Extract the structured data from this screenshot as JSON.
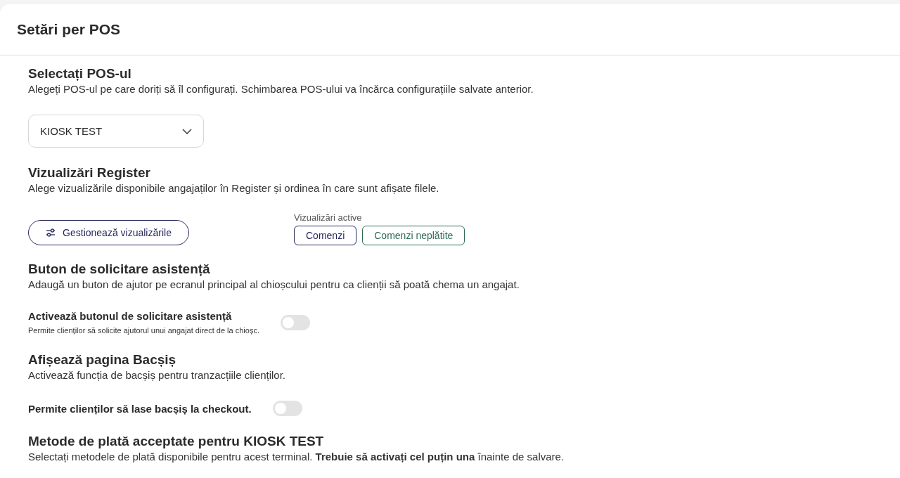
{
  "page": {
    "title": "Setări per POS"
  },
  "sections": [
    {
      "kind": "select",
      "title": "Selectați POS-ul",
      "description": "Alegeți POS-ul pe care doriți să îl configurați. Schimbarea POS-ului va încărca configurațiile salvate anterior.",
      "select": {
        "value": "KIOSK TEST"
      }
    },
    {
      "kind": "views",
      "title": "Vizualizări Register",
      "description": "Alege vizualizările disponibile angajaților în Register și ordinea în care sunt afișate filele.",
      "button": "Gestionează vizualizările",
      "active_label": "Vizualizări active",
      "chips": [
        {
          "label": "Comenzi",
          "color": "#27285c"
        },
        {
          "label": "Comenzi neplătite",
          "color": "#2e6b55"
        }
      ]
    },
    {
      "kind": "toggle",
      "title": "Buton de solicitare asistență",
      "description": "Adaugă un buton de ajutor pe ecranul principal al chioșcului pentru ca clienții să poată chema un angajat.",
      "setting": {
        "label": "Activează butonul de solicitare asistență",
        "hint": "Permite clienților să solicite ajutorul unui angajat direct de la chioșc.",
        "on": false
      }
    },
    {
      "kind": "toggle",
      "title": "Afișează pagina Bacșiș",
      "description": "Activează funcția de bacșiș pentru tranzacțiile clienților.",
      "setting": {
        "label": "Permite clienților să lase bacșiș la checkout.",
        "on": false
      }
    },
    {
      "kind": "text",
      "title": "Metode de plată acceptate pentru KIOSK TEST",
      "description": "Selectați metodele de plată disponibile pentru acest terminal. **Trebuie să activați cel puțin una** înainte de salvare."
    }
  ]
}
